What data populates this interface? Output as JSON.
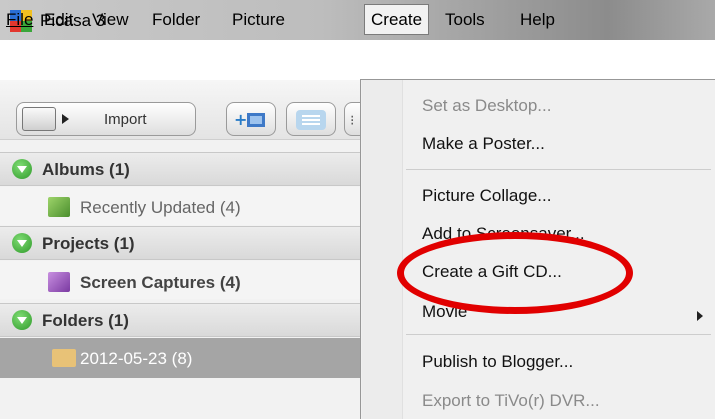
{
  "window": {
    "title": "Picasa 3",
    "icon": "picasa-logo-icon"
  },
  "menubar": {
    "file": "File",
    "edit": "Edit",
    "view": "View",
    "folder": "Folder",
    "picture": "Picture",
    "create": "Create",
    "tools": "Tools",
    "help": "Help"
  },
  "toolbar": {
    "import_label": "Import"
  },
  "library": {
    "albums": {
      "title": "Albums (1)",
      "items": [
        {
          "label": "Recently Updated (4)"
        }
      ]
    },
    "projects": {
      "title": "Projects (1)",
      "items": [
        {
          "label": "Screen Captures (4)"
        }
      ]
    },
    "folders": {
      "title": "Folders (1)",
      "items": [
        {
          "label": "2012-05-23 (8)",
          "selected": true
        }
      ]
    }
  },
  "create_menu": {
    "items": [
      {
        "label": "Set as Desktop...",
        "enabled": false
      },
      {
        "label": "Make a Poster...",
        "enabled": true
      },
      {
        "label": "Picture Collage...",
        "enabled": true
      },
      {
        "label": "Add to Screensaver...",
        "enabled": true
      },
      {
        "label": "Create a Gift CD...",
        "enabled": true,
        "highlighted": true
      },
      {
        "label": "Movie",
        "enabled": true,
        "has_submenu": true
      },
      {
        "label": "Publish to Blogger...",
        "enabled": true
      },
      {
        "label": "Export to TiVo(r) DVR...",
        "enabled": false
      }
    ]
  },
  "colors": {
    "highlight_ellipse": "#e10000",
    "selected_row": "#a5a5a5",
    "section_icon": "#2f9a2a"
  }
}
